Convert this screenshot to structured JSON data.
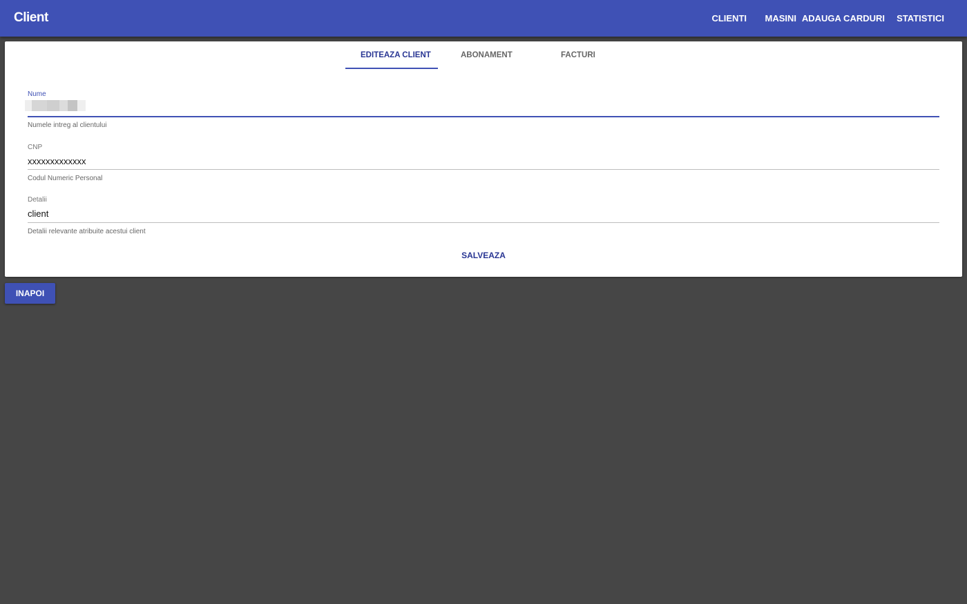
{
  "header": {
    "title": "Client",
    "nav": [
      "CLIENTI",
      "MASINI",
      "ADAUGA CARDURI",
      "STATISTICI"
    ]
  },
  "tabs": [
    {
      "label": "EDITEAZA CLIENT",
      "active": true
    },
    {
      "label": "ABONAMENT",
      "active": false
    },
    {
      "label": "FACTURI",
      "active": false
    }
  ],
  "form": {
    "name": {
      "label": "Nume",
      "value": "",
      "hint": "Numele intreg al clientului"
    },
    "cnp": {
      "label": "CNP",
      "value": "xxxxxxxxxxxxx",
      "hint": "Codul Numeric Personal"
    },
    "details": {
      "label": "Detalii",
      "value": "client",
      "hint": "Detalii relevante atribuite acestui client"
    }
  },
  "actions": {
    "save_label": "SALVEAZA",
    "back_label": "INAPOI"
  },
  "colors": {
    "primary": "#3f51b5",
    "primary_dark_text": "#283593",
    "background": "#464646",
    "card": "#ffffff"
  }
}
